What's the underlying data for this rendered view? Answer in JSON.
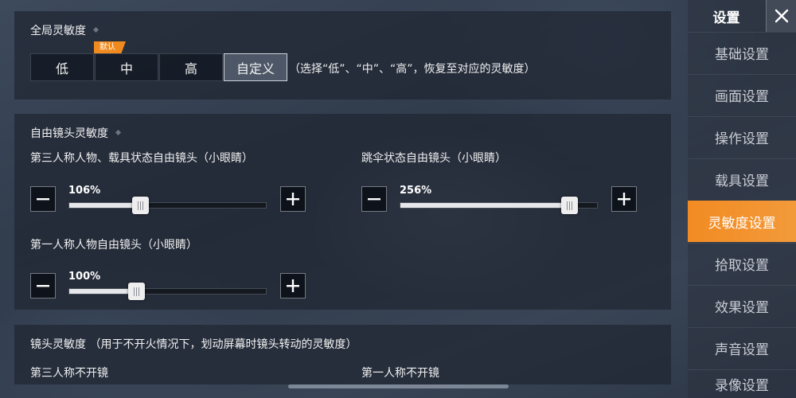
{
  "global": {
    "title": "全局灵敏度",
    "options": [
      "低",
      "中",
      "高",
      "自定义"
    ],
    "selected_index": 3,
    "default_badge": "默认",
    "hint": "（选择“低”、“中”、“高”，恢复至对应的灵敏度）"
  },
  "free_camera": {
    "title": "自由镜头灵敏度",
    "sliders": [
      {
        "label": "第三人称人物、载具状态自由镜头（小眼睛）",
        "value_text": "106%",
        "fraction": 0.36
      },
      {
        "label": "跳伞状态自由镜头（小眼睛）",
        "value_text": "256%",
        "fraction": 0.86
      },
      {
        "label": "第一人称人物自由镜头（小眼睛）",
        "value_text": "100%",
        "fraction": 0.34
      }
    ]
  },
  "camera": {
    "title": "镜头灵敏度 （用于不开火情况下，划动屏幕时镜头转动的灵敏度）",
    "third_person_label": "第三人称不开镜",
    "first_person_label": "第一人称不开镜"
  },
  "sidebar": {
    "title": "设置",
    "items": [
      "基础设置",
      "画面设置",
      "操作设置",
      "载具设置",
      "灵敏度设置",
      "拾取设置",
      "效果设置",
      "声音设置",
      "录像设置"
    ],
    "active_index": 4
  },
  "colors": {
    "accent": "#f28b22",
    "badge": "#f08a1e"
  },
  "icons": {
    "close": "close-icon",
    "minus": "minus-icon",
    "plus": "plus-icon",
    "section_marker": "diamond-icon"
  }
}
